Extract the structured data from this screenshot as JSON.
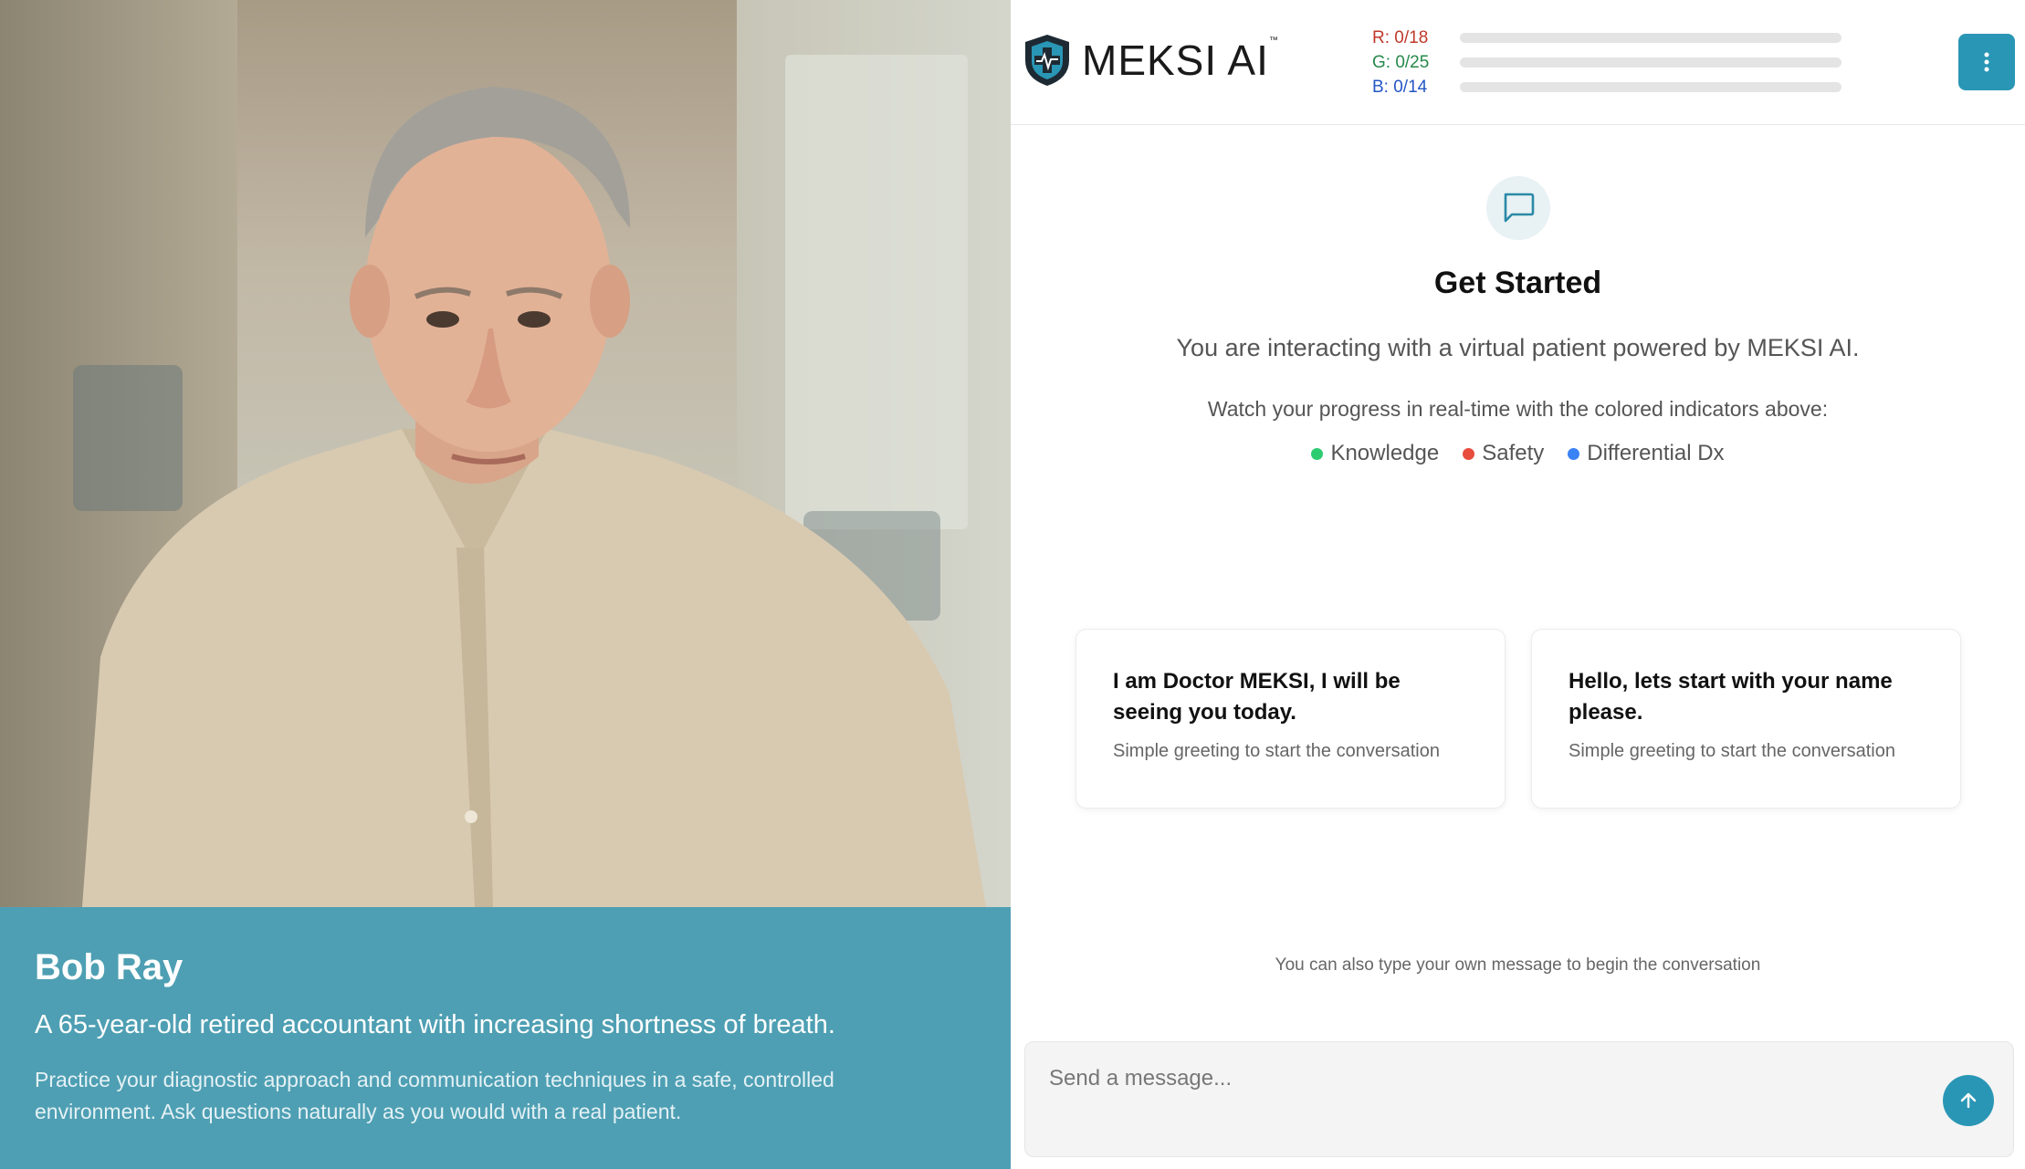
{
  "patient": {
    "name": "Bob Ray",
    "tagline": "A 65-year-old retired accountant with increasing shortness of breath.",
    "description": "Practice your diagnostic approach and communication techniques in a safe, controlled environment. Ask questions naturally as you would with a real patient."
  },
  "header": {
    "logo_text": "MEKSI AI",
    "logo_tm": "™",
    "scores": [
      {
        "label": "R: 0/18",
        "color": "#c0392b",
        "progress": 0
      },
      {
        "label": "G: 0/25",
        "color": "#27894a",
        "progress": 0
      },
      {
        "label": "B: 0/14",
        "color": "#2456c4",
        "progress": 0
      }
    ],
    "menu_icon": "vertical-dots-icon"
  },
  "main": {
    "title": "Get Started",
    "intro": "You are interacting with a virtual patient powered by MEKSI AI.",
    "watch": "Watch your progress in real-time with the colored indicators above:",
    "legend": [
      {
        "label": "Knowledge",
        "color": "#2ecc71"
      },
      {
        "label": "Safety",
        "color": "#e74c3c"
      },
      {
        "label": "Differential Dx",
        "color": "#3b82f6"
      }
    ],
    "suggestions": [
      {
        "title": "I am Doctor MEKSI, I will be seeing you today.",
        "subtitle": "Simple greeting to start the conversation"
      },
      {
        "title": "Hello, lets start with your name please.",
        "subtitle": "Simple greeting to start the conversation"
      }
    ],
    "hint": "You can also type your own message to begin the conversation"
  },
  "composer": {
    "placeholder": "Send a message...",
    "value": ""
  },
  "colors": {
    "accent": "#2a96b5",
    "info_panel": "#4e9fb3"
  }
}
